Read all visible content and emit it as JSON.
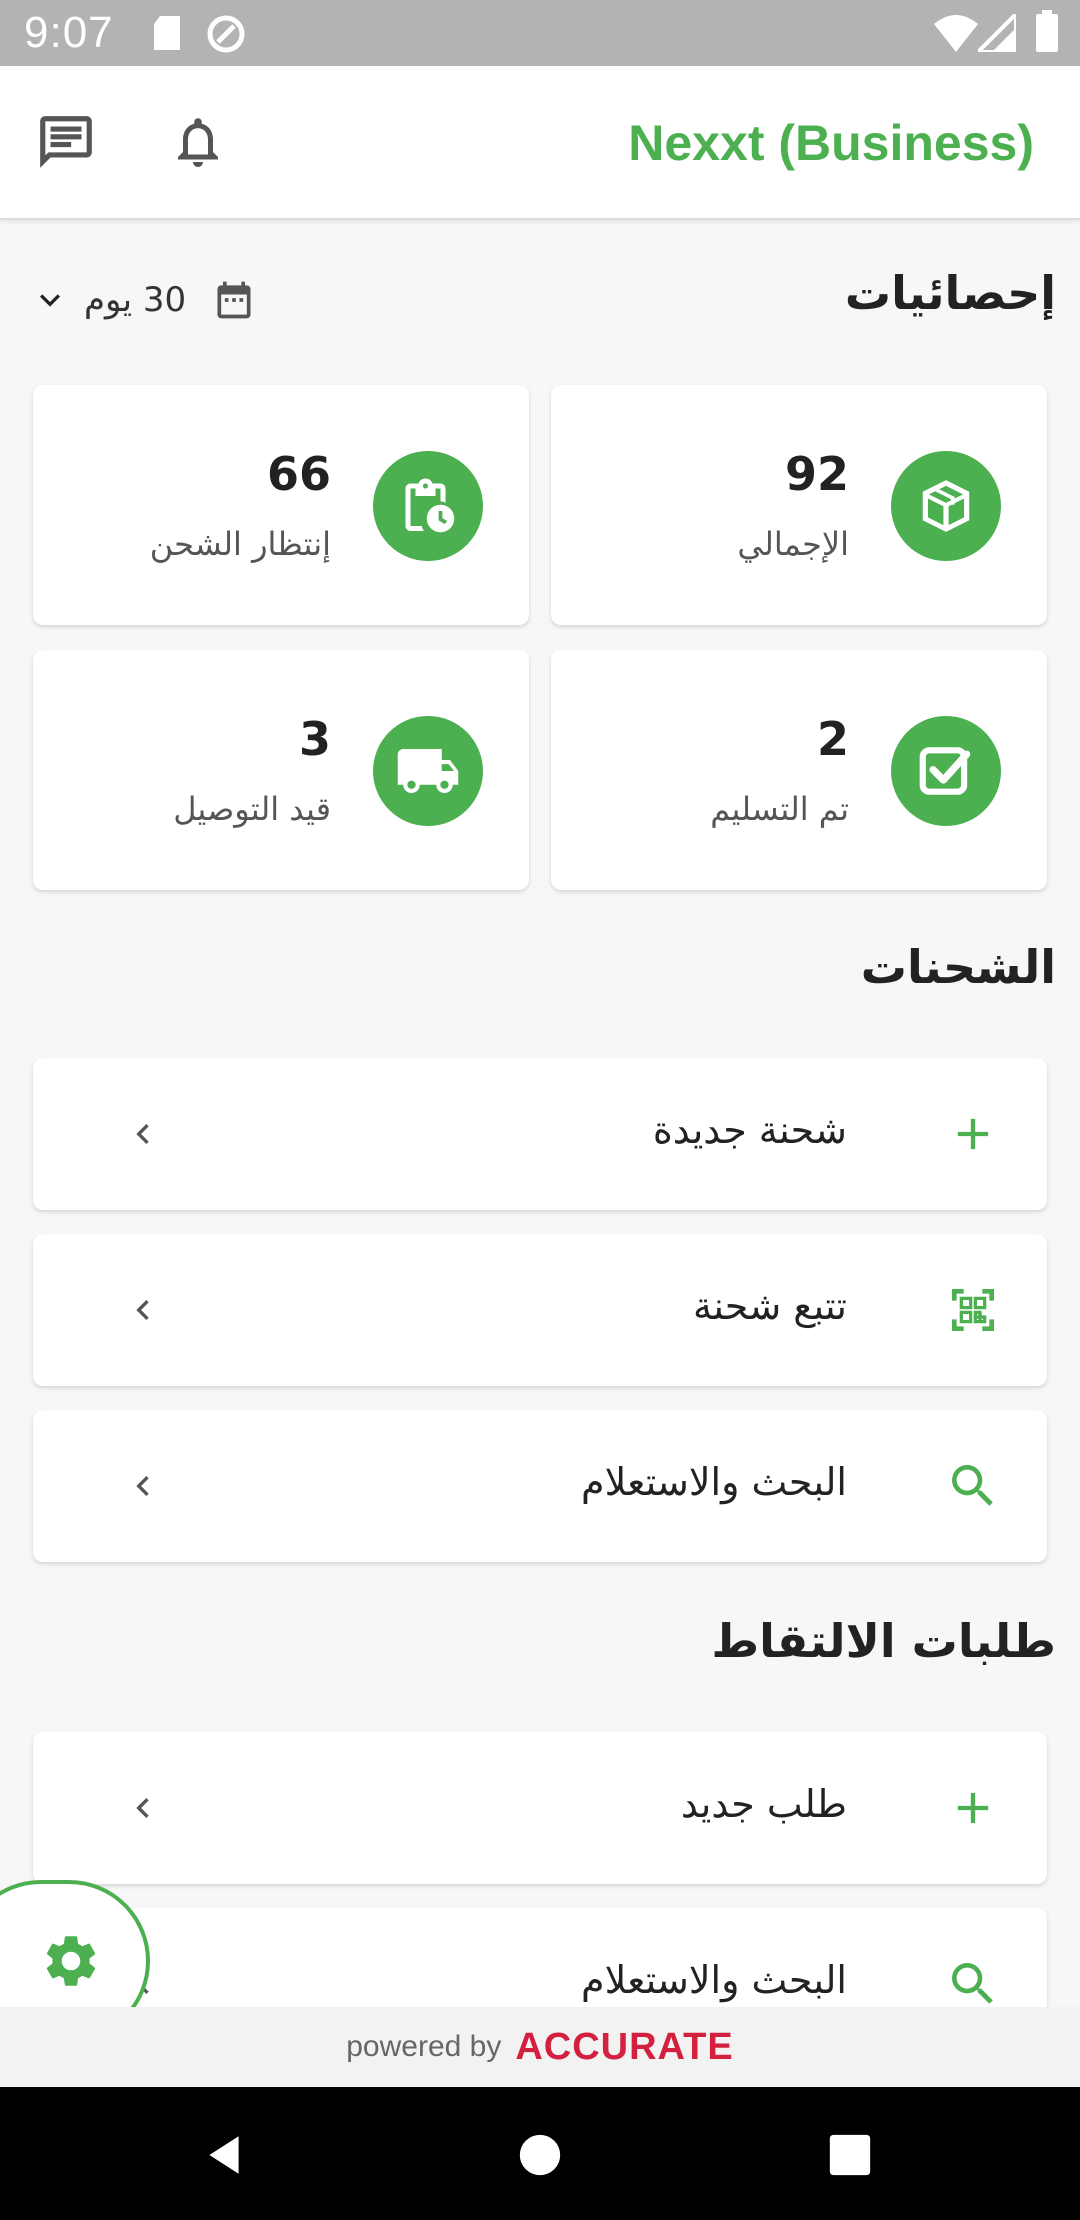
{
  "status_bar": {
    "time": "9:07",
    "icons": [
      "sd-card-icon",
      "sync-icon",
      "wifi-icon",
      "signal-icon",
      "battery-icon"
    ]
  },
  "app_bar": {
    "title": "Nexxt (Business)",
    "icons": [
      "chat-icon",
      "bell-icon"
    ]
  },
  "stats": {
    "title": "إحصائيات",
    "period": "30 يوم",
    "cards": [
      {
        "value": "92",
        "label": "الإجمالي",
        "icon": "box-icon"
      },
      {
        "value": "66",
        "label": "إنتظار الشحن",
        "icon": "clipboard-clock-icon"
      },
      {
        "value": "2",
        "label": "تم التسليم",
        "icon": "checkbox-icon"
      },
      {
        "value": "3",
        "label": "قيد التوصيل",
        "icon": "truck-icon"
      }
    ]
  },
  "shipments": {
    "title": "الشحنات",
    "items": [
      {
        "label": "شحنة جديدة",
        "icon": "plus-icon"
      },
      {
        "label": "تتبع شحنة",
        "icon": "qr-code-icon"
      },
      {
        "label": "البحث والاستعلام",
        "icon": "search-icon"
      }
    ]
  },
  "pickups": {
    "title": "طلبات الالتقاط",
    "items": [
      {
        "label": "طلب جديد",
        "icon": "plus-icon"
      },
      {
        "label": "البحث والاستعلام",
        "icon": "search-icon"
      }
    ]
  },
  "footer": {
    "powered_by": "powered by",
    "brand": "ACCURATE"
  },
  "colors": {
    "accent": "#4caf50",
    "brand": "#d3203f",
    "status_bar": "#b3b3b3"
  }
}
